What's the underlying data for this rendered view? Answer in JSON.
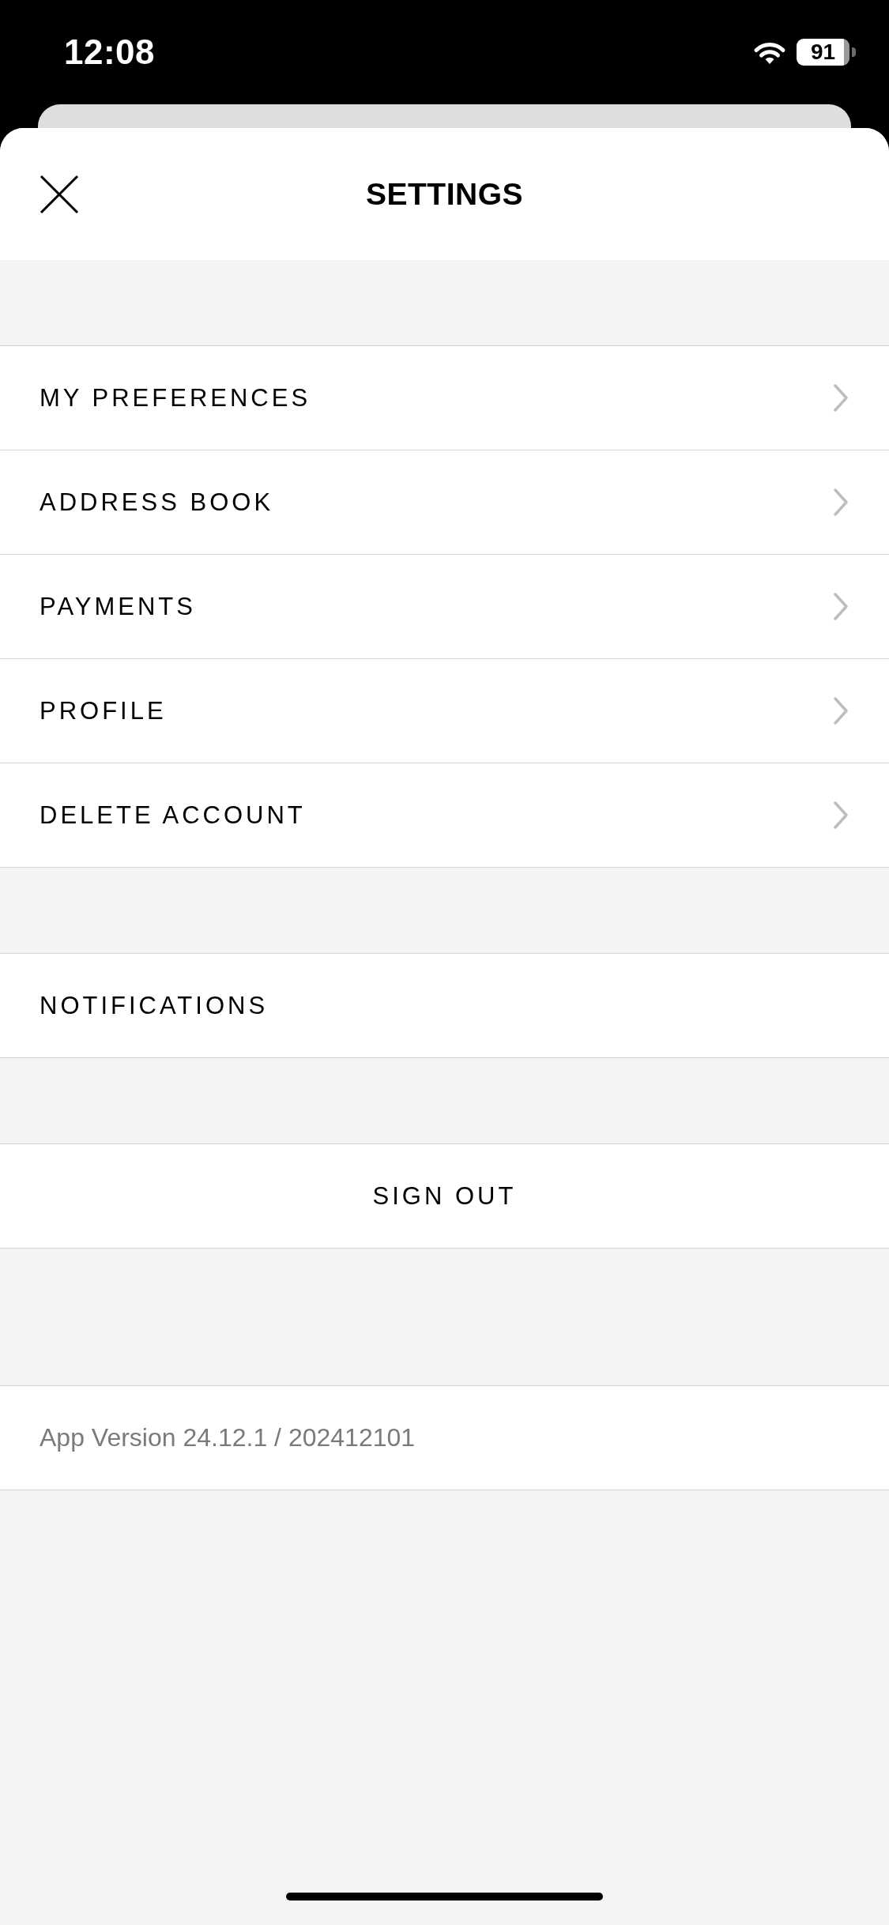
{
  "status_bar": {
    "time": "12:08",
    "battery": "91"
  },
  "sheet": {
    "title": "SETTINGS"
  },
  "groups": [
    {
      "items": [
        {
          "label": "MY PREFERENCES",
          "kind": "link"
        },
        {
          "label": "ADDRESS BOOK",
          "kind": "link"
        },
        {
          "label": "PAYMENTS",
          "kind": "link"
        },
        {
          "label": "PROFILE",
          "kind": "link"
        },
        {
          "label": "DELETE ACCOUNT",
          "kind": "link"
        }
      ]
    },
    {
      "items": [
        {
          "label": "NOTIFICATIONS",
          "kind": "plain"
        }
      ]
    },
    {
      "items": [
        {
          "label": "SIGN OUT",
          "kind": "action"
        }
      ]
    },
    {
      "items": [
        {
          "label": "App Version 24.12.1 / 202412101",
          "kind": "info"
        }
      ]
    }
  ]
}
